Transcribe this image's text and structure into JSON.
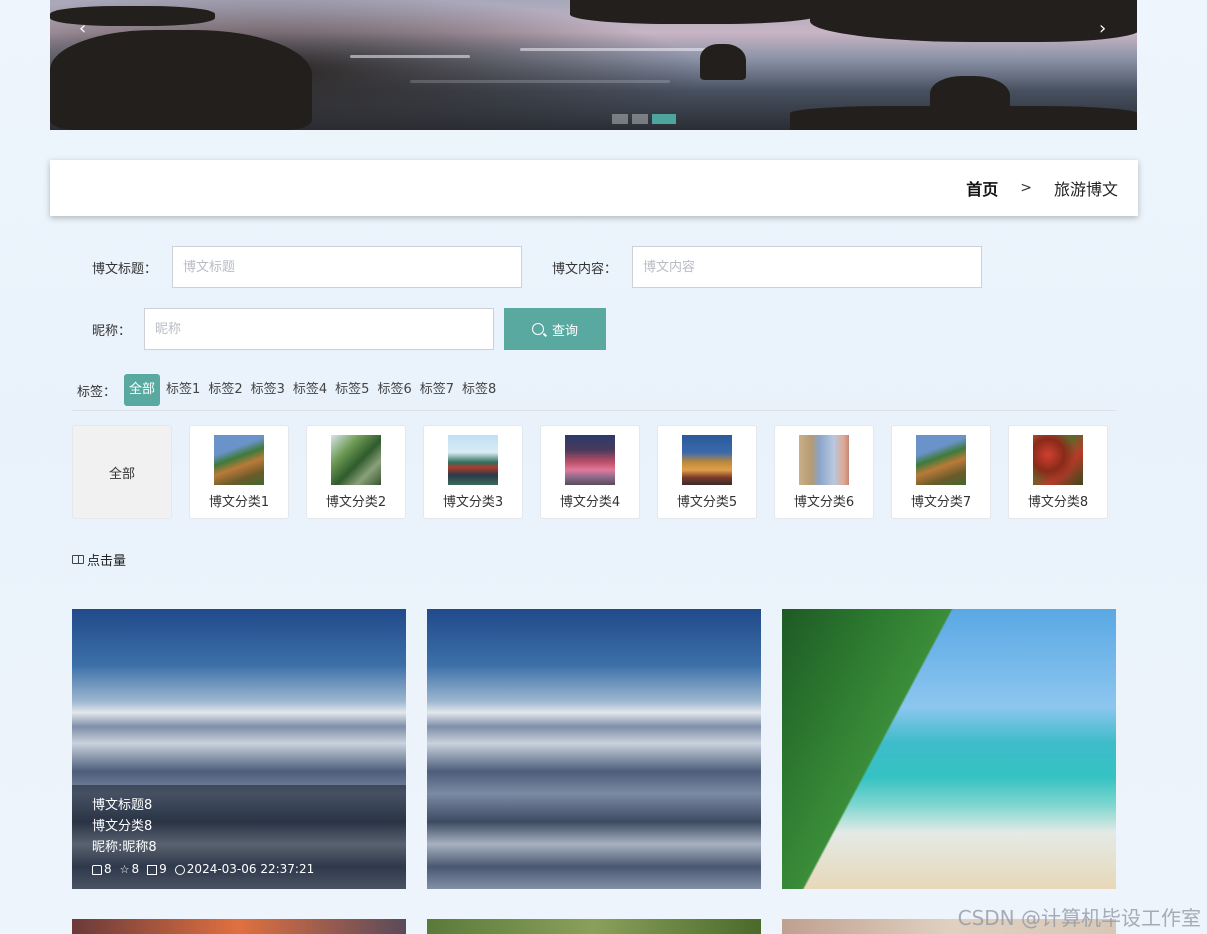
{
  "banner": {
    "prev": "‹",
    "next": "›",
    "slides": 3,
    "active": 2
  },
  "breadcrumb": {
    "home": "首页",
    "separator": ">",
    "current": "旅游博文"
  },
  "form": {
    "title_label": "博文标题：",
    "title_placeholder": "博文标题",
    "content_label": "博文内容：",
    "content_placeholder": "博文内容",
    "nickname_label": "昵称：",
    "nickname_placeholder": "昵称",
    "search_button": "查询"
  },
  "tags": {
    "label": "标签：",
    "items": [
      "全部",
      "标签1",
      "标签2",
      "标签3",
      "标签4",
      "标签5",
      "标签6",
      "标签7",
      "标签8"
    ]
  },
  "categories": [
    "全部",
    "博文分类1",
    "博文分类2",
    "博文分类3",
    "博文分类4",
    "博文分类5",
    "博文分类6",
    "博文分类7",
    "博文分类8"
  ],
  "sort": {
    "label": "点击量"
  },
  "cards": [
    {
      "title": "博文标题8",
      "category": "博文分类8",
      "author": "昵称:昵称8",
      "likes": "8",
      "favorites": "8",
      "comments": "9",
      "time": "2024-03-06 22:37:21"
    }
  ],
  "watermark": "CSDN @计算机毕设工作室",
  "colors": {
    "accent": "#5aa9a1"
  }
}
